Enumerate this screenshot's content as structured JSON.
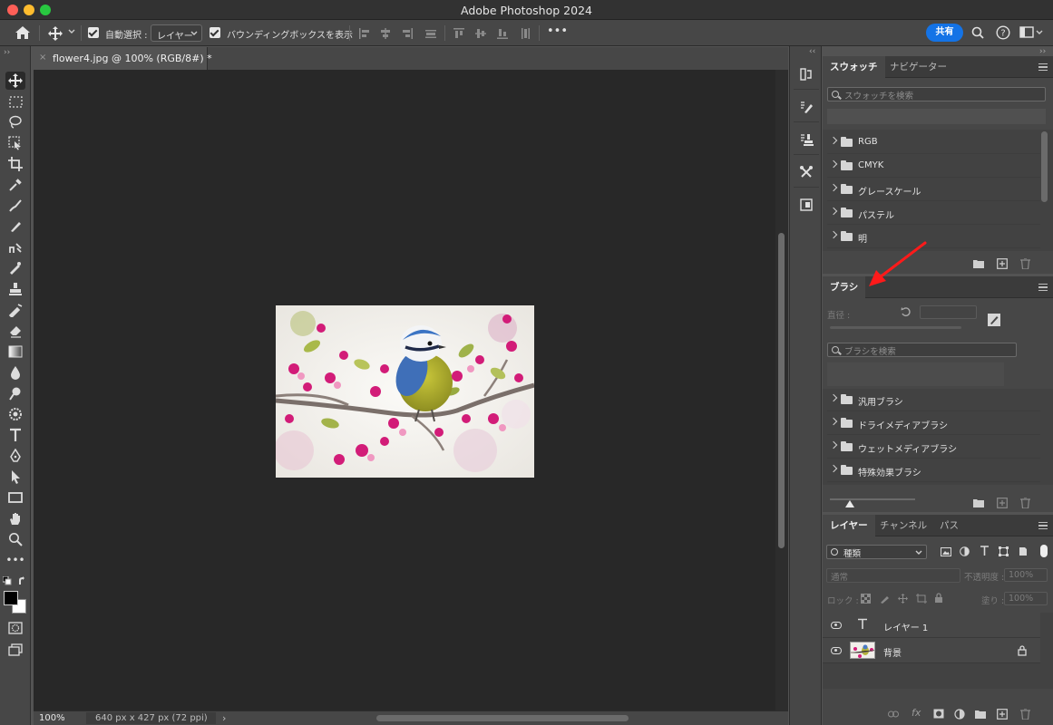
{
  "window": {
    "title": "Adobe Photoshop 2024"
  },
  "options_bar": {
    "auto_select_label": "自動選択 :",
    "auto_select_value": "レイヤー",
    "show_bbox_label": "バウンディングボックスを表示",
    "more": "•••",
    "share_label": "共有"
  },
  "document": {
    "tab_title": "flower4.jpg @ 100% (RGB/8#) *",
    "close": "×"
  },
  "status": {
    "zoom": "100%",
    "info": "640 px x 427 px (72 ppi)",
    "arrow": "›"
  },
  "toolbar": {
    "more": "•••"
  },
  "swatches": {
    "tabs": [
      "スウォッチ",
      "ナビゲーター"
    ],
    "search_placeholder": "スウォッチを検索",
    "groups": [
      "RGB",
      "CMYK",
      "グレースケール",
      "パステル",
      "明"
    ]
  },
  "brush": {
    "tab": "ブラシ",
    "size_label": "直径 :",
    "search_placeholder": "ブラシを検索",
    "groups": [
      "汎用ブラシ",
      "ドライメディアブラシ",
      "ウェットメディアブラシ",
      "特殊効果ブラシ"
    ]
  },
  "layers": {
    "tabs": [
      "レイヤー",
      "チャンネル",
      "パス"
    ],
    "filter_label": "種類",
    "blend_mode": "通常",
    "opacity_label": "不透明度 :",
    "opacity_value": "100%",
    "lock_label": "ロック :",
    "fill_label": "塗り :",
    "fill_value": "100%",
    "items": [
      {
        "name": "レイヤー 1",
        "kind": "text"
      },
      {
        "name": "背景",
        "kind": "image",
        "locked": true
      }
    ]
  },
  "annotation": {
    "arrow_color": "#ff1a1a",
    "points_to": "ブラシ"
  },
  "colors": {
    "accent": "#1473e6",
    "canvas_bg": "#282828",
    "panel_bg": "#474747"
  }
}
